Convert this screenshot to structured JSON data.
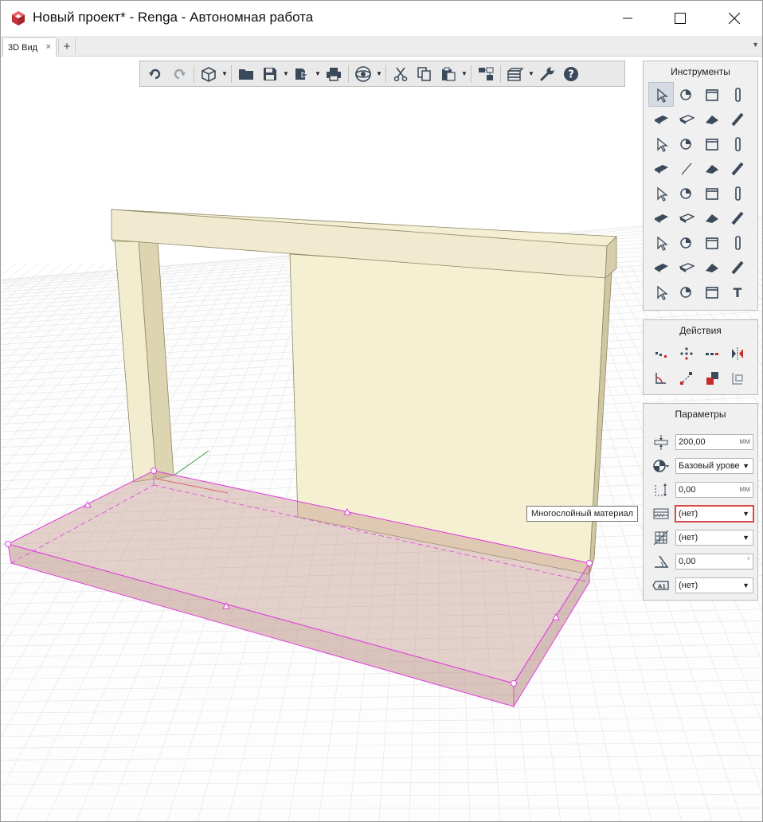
{
  "window": {
    "title": "Новый проект* - Renga - Автономная работа",
    "controls": {
      "minimize": "—",
      "maximize": "☐",
      "close": "✕"
    },
    "app_icon": "renga-logo-icon"
  },
  "tabs": {
    "items": [
      {
        "label": "3D Вид",
        "close": "×"
      }
    ],
    "add": "+",
    "menu": "▼"
  },
  "toolbar": {
    "icons": [
      "undo-icon",
      "redo-icon",
      "view-cube-icon",
      "open-folder-icon",
      "save-icon",
      "export-icon",
      "print-icon",
      "orbit-icon",
      "cut-icon",
      "copy-icon",
      "paste-icon",
      "properties-icon",
      "layers-icon",
      "settings-wrench-icon",
      "help-icon"
    ]
  },
  "tools_panel": {
    "title": "Инструменты",
    "items": [
      "select-icon",
      "annotation-icon",
      "room-icon",
      "column-icon",
      "slab-icon",
      "wall-icon",
      "roof-icon",
      "beam-icon",
      "stairs-icon",
      "ramp-icon",
      "door-icon",
      "window-icon",
      "railing-icon",
      "line-icon",
      "equipment-icon",
      "duct-icon",
      "plumbing-fixture-icon",
      "mechanical-equipment-icon",
      "duct-fitting-icon",
      "pipe-icon",
      "pipe-accessory-icon",
      "duct-accessory-icon",
      "pipe-fitting-icon",
      "duct-segment-icon",
      "electrical-icon",
      "lighting-icon",
      "electrical-device-icon",
      "electrical-panel-icon",
      "elevator-icon",
      "element-icon",
      "assembly-icon",
      "opening-icon",
      "dimension-icon",
      "route-icon",
      "hatch-icon",
      "text-icon"
    ]
  },
  "actions_panel": {
    "title": "Действия",
    "items": [
      "move-icon",
      "rotate-icon",
      "copy-array-icon",
      "mirror-icon",
      "trim-icon",
      "align-icon",
      "split-icon",
      "transform-icon"
    ]
  },
  "params_panel": {
    "title": "Параметры",
    "thickness": {
      "value": "200,00",
      "unit": "мм"
    },
    "level": {
      "value": "Базовый урове"
    },
    "offset": {
      "value": "0,00",
      "unit": "мм"
    },
    "material": {
      "value": "(нет)",
      "tooltip": "Многослойный материал"
    },
    "style": {
      "value": "(нет)"
    },
    "angle": {
      "value": "0,00",
      "unit": "°"
    },
    "mark": {
      "value": "(нет)"
    },
    "dropdown_arrow": "▼"
  },
  "colors": {
    "grid_line": "#e3e3e3",
    "element_fill": "#f2eccd",
    "element_side": "#ddd5b4",
    "slab_fill": "#d8c5c0",
    "selection": "#e040e0",
    "highlight": "#d94848"
  }
}
